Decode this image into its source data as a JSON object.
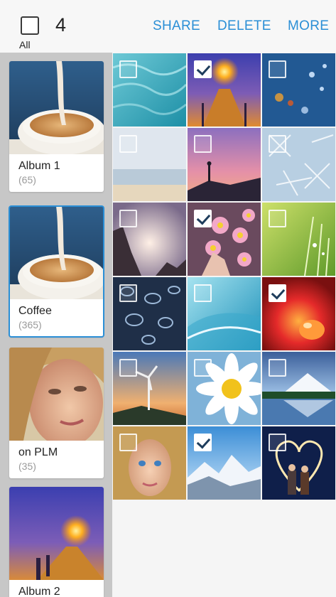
{
  "header": {
    "select_all_label": "All",
    "selected_count": "4",
    "actions": {
      "share": "SHARE",
      "delete": "DELETE",
      "more": "MORE"
    }
  },
  "albums": [
    {
      "name": "Album 1",
      "count": "(65)"
    },
    {
      "name": "Coffee",
      "count": "(365)",
      "selected": true
    },
    {
      "name": "on PLM",
      "count": "(35)"
    },
    {
      "name": "Album 2"
    }
  ],
  "grid": [
    {
      "subject": "teal water surface",
      "checked": false
    },
    {
      "subject": "pier at sunset",
      "checked": true
    },
    {
      "subject": "raindrops bokeh",
      "checked": false
    },
    {
      "subject": "misty beach",
      "checked": false
    },
    {
      "subject": "yoga silhouette at dusk",
      "checked": false
    },
    {
      "subject": "frost pattern",
      "checked": false
    },
    {
      "subject": "sun over rocky hills",
      "checked": false
    },
    {
      "subject": "pink daisies in hand",
      "checked": true
    },
    {
      "subject": "green dewy grass",
      "checked": false
    },
    {
      "subject": "water droplets on dark surface",
      "checked": false
    },
    {
      "subject": "blue abstract waves",
      "checked": false
    },
    {
      "subject": "red droplet macro",
      "checked": true
    },
    {
      "subject": "wind turbine at sunset",
      "checked": false
    },
    {
      "subject": "white daisy close-up",
      "checked": false
    },
    {
      "subject": "snowy mountain lake",
      "checked": false
    },
    {
      "subject": "blue-eyed girl portrait",
      "checked": false
    },
    {
      "subject": "snowy alpine peaks",
      "checked": true
    },
    {
      "subject": "couple with light heart",
      "checked": false
    }
  ]
}
